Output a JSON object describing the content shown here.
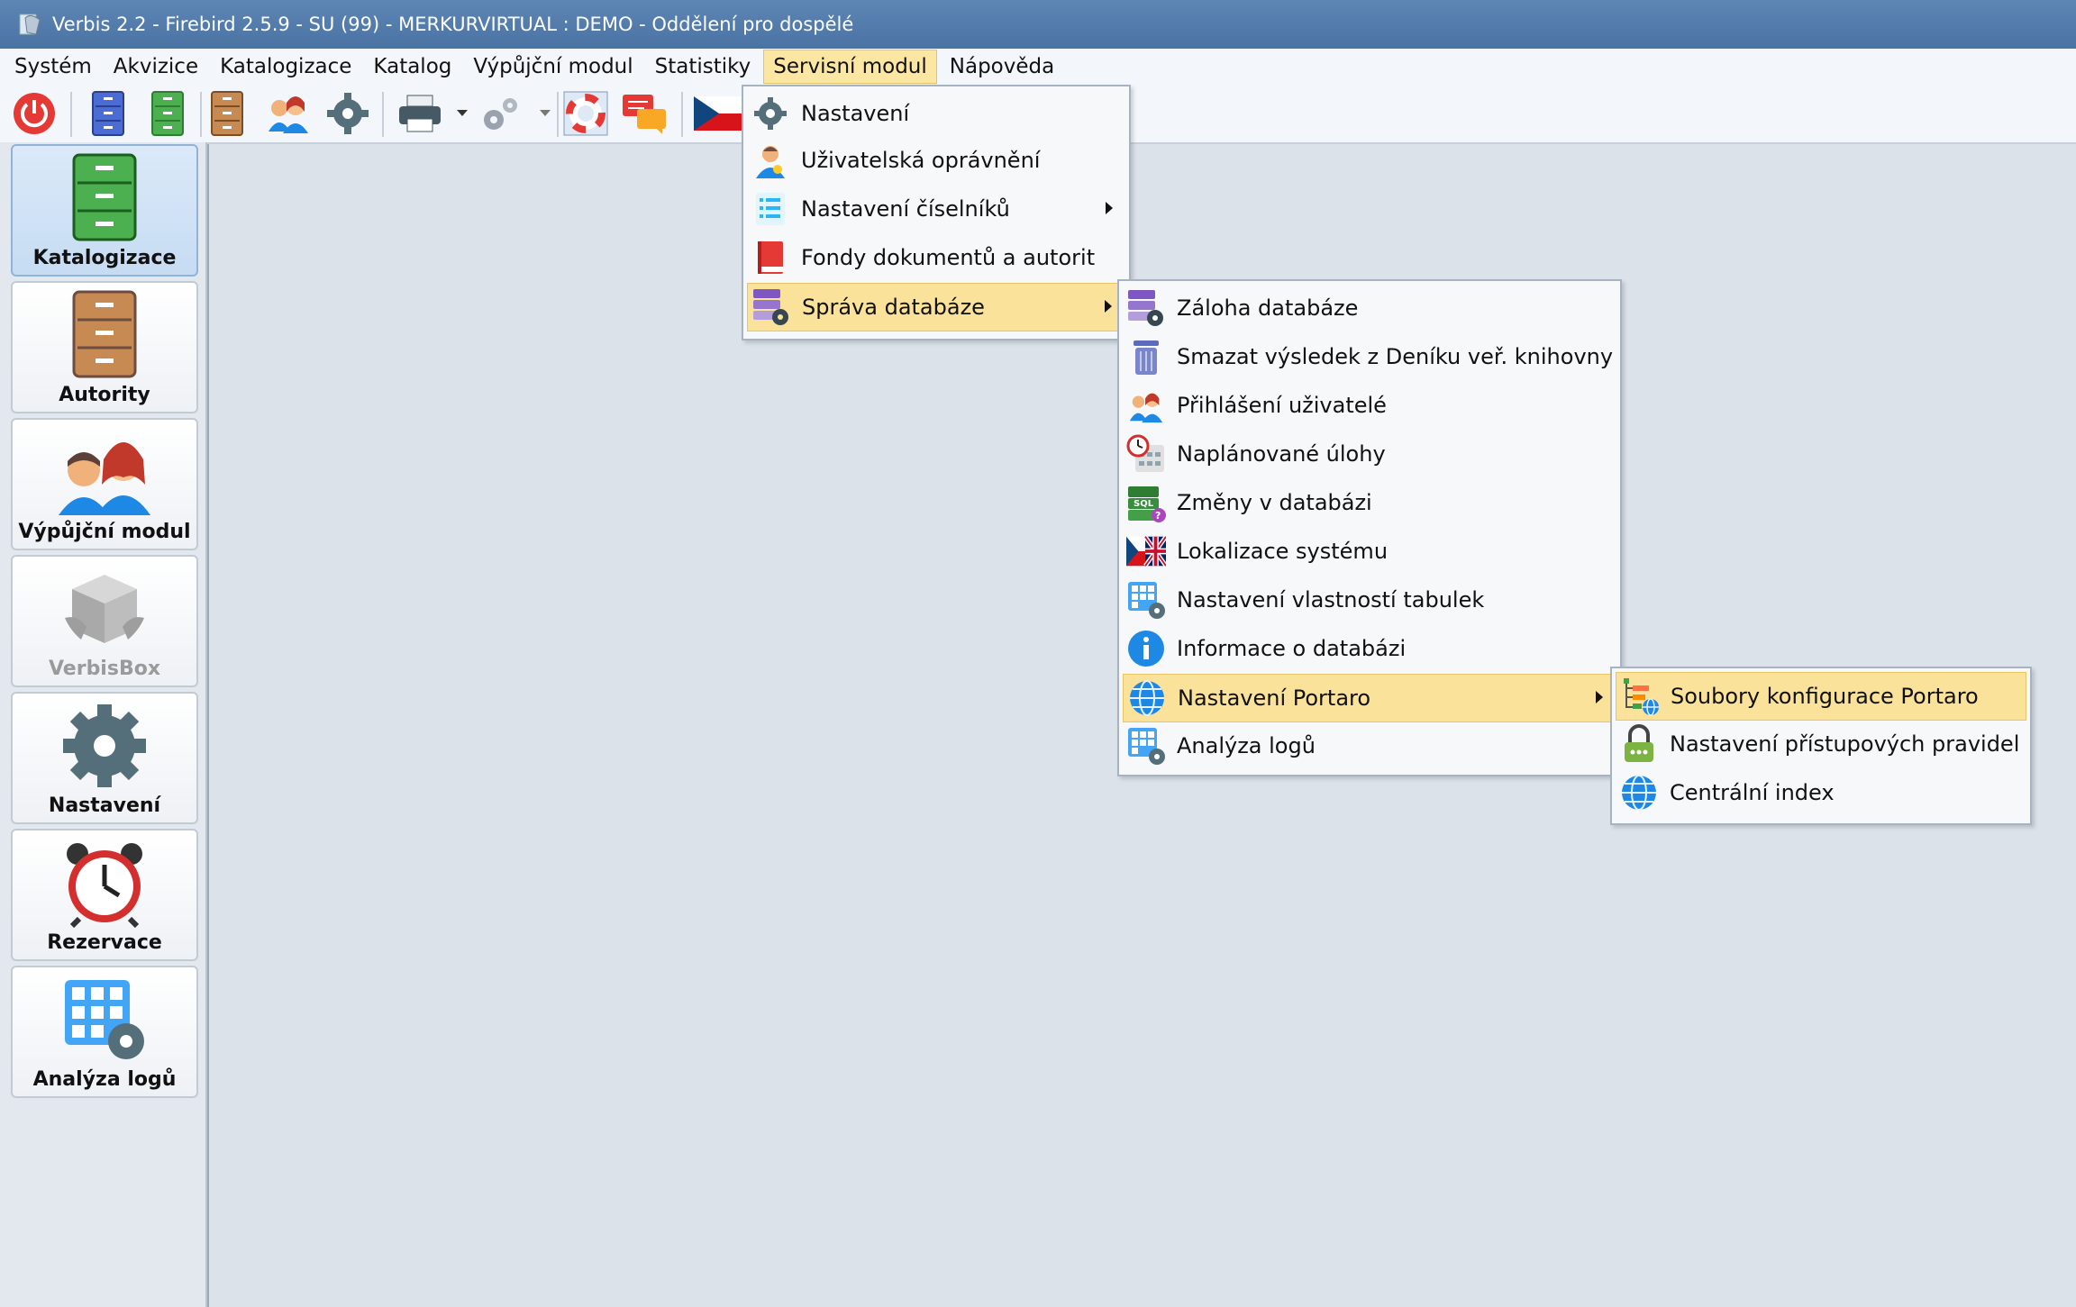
{
  "window": {
    "title": "Verbis 2.2 - Firebird 2.5.9 - SU (99) - MERKURVIRTUAL : DEMO - Oddělení pro dospělé"
  },
  "menubar": [
    {
      "label": "Systém"
    },
    {
      "label": "Akvizice"
    },
    {
      "label": "Katalogizace"
    },
    {
      "label": "Katalog"
    },
    {
      "label": "Výpůjční modul"
    },
    {
      "label": "Statistiky"
    },
    {
      "label": "Servisní modul"
    },
    {
      "label": "Nápověda"
    }
  ],
  "sidebar": [
    {
      "label": "Katalogizace",
      "icon": "green-cabinet-icon"
    },
    {
      "label": "Autority",
      "icon": "brown-cabinet-icon"
    },
    {
      "label": "Výpůjční modul",
      "icon": "users-icon"
    },
    {
      "label": "VerbisBox",
      "icon": "box-icon"
    },
    {
      "label": "Nastavení",
      "icon": "gear-icon"
    },
    {
      "label": "Rezervace",
      "icon": "alarm-clock-icon"
    },
    {
      "label": "Analýza logů",
      "icon": "grid-gear-icon"
    }
  ],
  "servis_menu": [
    {
      "label": "Nastavení",
      "icon": "gear-icon"
    },
    {
      "label": "Uživatelská oprávnění",
      "icon": "user-icon"
    },
    {
      "label": "Nastavení číselníků",
      "icon": "list-icon"
    },
    {
      "label": "Fondy dokumentů a autorit",
      "icon": "book-icon"
    },
    {
      "label": "Správa databáze",
      "icon": "database-gear-icon"
    }
  ],
  "db_menu": [
    {
      "label": "Záloha databáze",
      "icon": "database-gear-icon"
    },
    {
      "label": "Smazat výsledek z Deníku veř. knihovny",
      "icon": "trash-icon"
    },
    {
      "label": "Přihlášení uživatelé",
      "icon": "users-icon"
    },
    {
      "label": "Naplánované úlohy",
      "icon": "calendar-clock-icon"
    },
    {
      "label": "Změny v databázi",
      "icon": "sql-icon"
    },
    {
      "label": "Lokalizace systému",
      "icon": "flags-icon"
    },
    {
      "label": "Nastavení vlastností tabulek",
      "icon": "table-gear-icon"
    },
    {
      "label": "Informace o databázi",
      "icon": "info-icon"
    },
    {
      "label": "Nastavení Portaro",
      "icon": "globe-icon"
    },
    {
      "label": "Analýza logů",
      "icon": "table-gear-icon"
    }
  ],
  "portaro_menu": [
    {
      "label": "Soubory konfigurace Portaro",
      "icon": "tree-globe-icon"
    },
    {
      "label": "Nastavení přístupových pravidel",
      "icon": "lock-icon"
    },
    {
      "label": "Centrální index",
      "icon": "globe-icon"
    }
  ],
  "colors": {
    "titlebar": "#4a73a3",
    "highlight": "#fbe29a",
    "menu_bg": "#f7f8fa"
  }
}
